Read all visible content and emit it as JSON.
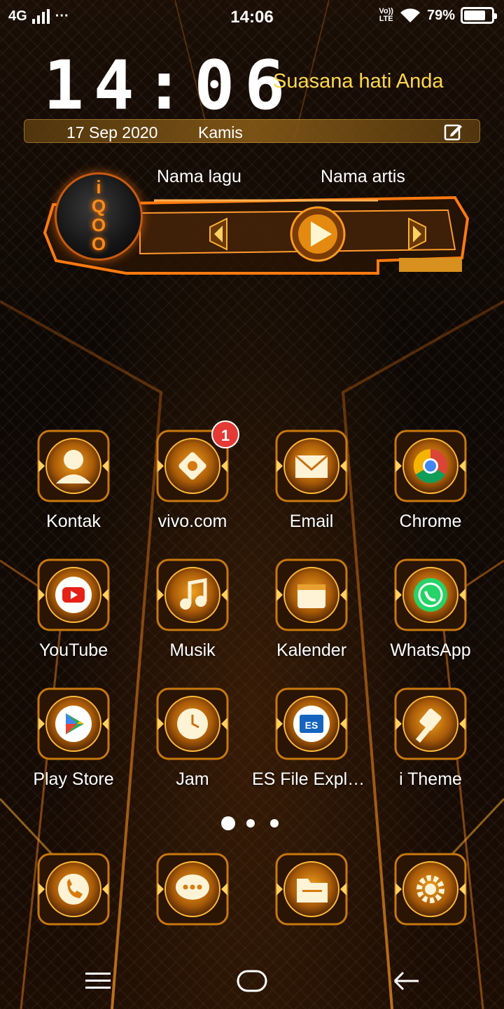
{
  "status_bar": {
    "network": "4G",
    "more": "···",
    "time": "14:06",
    "volte_top": "Vo))",
    "volte_bottom": "LTE",
    "battery_percent": "79%",
    "battery_level": 0.79
  },
  "clock_widget": {
    "time": "14:06",
    "mood": "Suasana hati Anda",
    "date": "17 Sep 2020",
    "day": "Kamis",
    "edit_icon": "edit-icon"
  },
  "music_widget": {
    "song": "Nama lagu",
    "artist": "Nama artis",
    "logo_text": [
      "i",
      "Q",
      "O",
      "O"
    ]
  },
  "apps": [
    {
      "label": "Kontak",
      "icon": "contacts-icon"
    },
    {
      "label": "vivo.com",
      "icon": "vivo-icon",
      "badge": "1"
    },
    {
      "label": "Email",
      "icon": "email-icon"
    },
    {
      "label": "Chrome",
      "icon": "chrome-icon"
    },
    {
      "label": "YouTube",
      "icon": "youtube-icon"
    },
    {
      "label": "Musik",
      "icon": "music-icon"
    },
    {
      "label": "Kalender",
      "icon": "calendar-icon"
    },
    {
      "label": "WhatsApp",
      "icon": "whatsapp-icon"
    },
    {
      "label": "Play Store",
      "icon": "play-store-icon"
    },
    {
      "label": "Jam",
      "icon": "clock-icon"
    },
    {
      "label": "ES File Explo…",
      "icon": "es-file-explorer-icon"
    },
    {
      "label": "i Theme",
      "icon": "theme-icon"
    }
  ],
  "dock": [
    {
      "icon": "phone-icon"
    },
    {
      "icon": "messages-icon"
    },
    {
      "icon": "files-icon"
    },
    {
      "icon": "settings-icon"
    }
  ],
  "page_indicator": {
    "pages": 3,
    "current": 1
  },
  "colors": {
    "accent": "#ff8a1c",
    "mood_text": "#ffd84d",
    "badge": "#e53935"
  }
}
